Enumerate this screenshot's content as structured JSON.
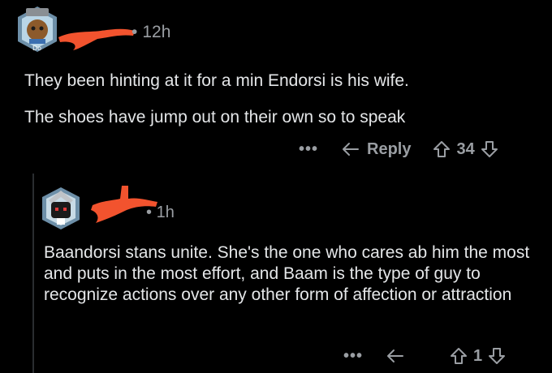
{
  "comment": {
    "time": "12h",
    "paragraphs": [
      "They been hinting at it for a min Endorsi is his wife.",
      "The shoes have jump out on their own so to speak"
    ],
    "more_label": "•••",
    "reply_label": "Reply",
    "score": "34"
  },
  "reply": {
    "time": "1h",
    "body": "Baandorsi stans unite. She's the one who cares ab him the most and puts in the most effort, and Baam is the type of guy to recognize actions over any other form of affection or attraction",
    "more_label": "•••",
    "score": "1"
  },
  "colors": {
    "background": "#000000",
    "text": "#e4e6e8",
    "meta": "#9a9ea3",
    "redaction": "#f2532e"
  }
}
